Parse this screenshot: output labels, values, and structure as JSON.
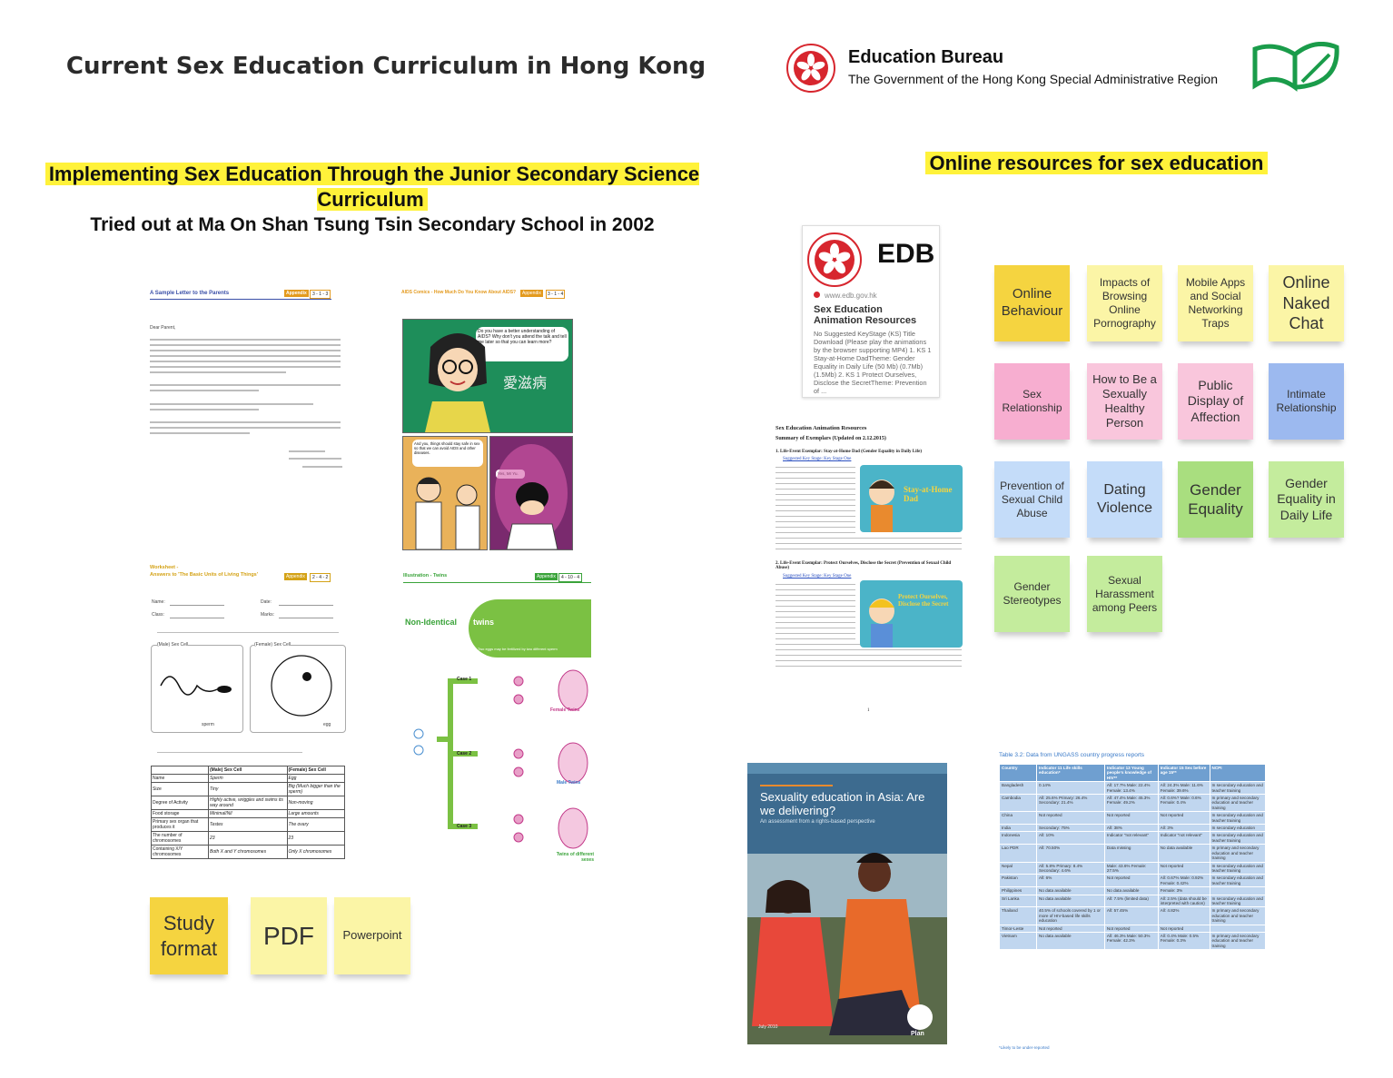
{
  "title": "Current Sex Education Curriculum in Hong Kong",
  "edb": {
    "name": "Education Bureau",
    "government": "The Government of the Hong Kong Special Administrative Region"
  },
  "section_left": {
    "title": "Implementing Sex Education Through the Junior Secondary Science Curriculum",
    "subtitle": "Tried out at Ma On Shan Tsung Tsin Secondary School in 2002"
  },
  "documents": {
    "letter": {
      "heading": "A Sample Letter to the Parents",
      "appendix": "Appendix",
      "appendix_no": "3 - 1 - 3",
      "greeting": "Dear Parent,"
    },
    "comic": {
      "heading": "AIDS Comics - How Much Do You Know About AIDS?",
      "appendix": "Appendix",
      "appendix_no": "3 - 1 - 4",
      "bubble1": "Do you have a better understanding of AIDS? Why don't you attend the talk and tell me later so that you can learn more?",
      "chinese": "愛滋病",
      "bubble2": "And you, things should stay safe in sex so that we can avoid AIDS and other diseases.",
      "bubble3": "Yes, Mr Yu."
    },
    "worksheet": {
      "heading": "Worksheet -",
      "heading2": "Answers to 'The Basic Units of Living Things'",
      "appendix": "Appendix",
      "appendix_no": "2 - 4 - 2",
      "name_label": "Name:",
      "class_label": "Class:",
      "date_label": "Date:",
      "marks_label": "Marks:",
      "male_cell": "(Male) Sex Cell",
      "female_cell": "(Female) Sex Cell",
      "sperm": "sperm",
      "egg": "egg",
      "col_male": "(Male) Sex Cell",
      "col_female": "(Female) Sex Cell",
      "rows": [
        [
          "Name",
          "Sperm",
          "Egg"
        ],
        [
          "Size",
          "Tiny",
          "Big (Much bigger than the sperm)"
        ],
        [
          "Degree of Activity",
          "Highly active, wriggles and swims its way around",
          "Non-moving"
        ],
        [
          "Food storage",
          "Minimal/Nil",
          "Large amounts"
        ],
        [
          "Primary sex organ that produces it",
          "Testes",
          "The ovary"
        ],
        [
          "The number of chromosomes",
          "23",
          "23"
        ],
        [
          "Containing X/Y chromosomes",
          "Both X and Y chromosomes",
          "Only X chromosomes"
        ]
      ]
    },
    "twins": {
      "heading": "Illustration - Twins",
      "appendix": "Appendix",
      "appendix_no": "4 - 10 - 4",
      "banner_left": "Non-Identical",
      "banner_right": "twins",
      "banner_note": "Two eggs may be fertilized by two different sperm",
      "case1": "Case 1",
      "case2": "Case 2",
      "case3": "Case 3",
      "female_twins": "Female Twins",
      "male_twins": "Male Twins",
      "mixed_twins": "Twins of different sexes"
    }
  },
  "study_notes": [
    {
      "label": "Study format",
      "color": "yellow"
    },
    {
      "label": "PDF",
      "color": "lyellow"
    },
    {
      "label": "Powerpoint",
      "color": "lyellow"
    }
  ],
  "section_right": {
    "title": "Online resources for sex education"
  },
  "resource_card": {
    "logo_text": "EDB",
    "url": "www.edb.gov.hk",
    "title": "Sex Education Animation Resources",
    "description": "No Suggested KeyStage (KS) Title Download (Please play the animations by the browser supporting MP4) 1. KS 1 Stay-at-Home DadTheme: Gender Equality in Daily Life (50 Mb) (0.7Mb) (1.5Mb) 2. KS 1 Protect Ourselves, Disclose the SecretTheme: Prevention of ..."
  },
  "animation_doc": {
    "title": "Sex Education Animation Resources",
    "subtitle": "Summary of Exemplars (Updated on 2.12.2015)",
    "item1_title": "1. Life-Event Exemplar: Stay-at-Home Dad (Gender Equality in Daily Life)",
    "item1_stage": "Suggested Key Stage: Key Stage One",
    "item1_thumb": "Stay-at-Home Dad",
    "item2_title": "2. Life-Event Exemplar: Protect Ourselves, Disclose the Secret (Prevention of Sexual Child Abuse)",
    "item2_stage": "Suggested Key Stage: Key Stage One",
    "item2_thumb": "Protect Ourselves, Disclose the Secret",
    "page_no": "1"
  },
  "topic_notes": [
    {
      "label": "Online Behaviour",
      "color": "yellow"
    },
    {
      "label": "Impacts of Browsing Online Pornography",
      "color": "lyellow"
    },
    {
      "label": "Mobile Apps and Social Networking Traps",
      "color": "lyellow"
    },
    {
      "label": "Online Naked Chat",
      "color": "lyellow"
    },
    {
      "label": "Sex Relationship",
      "color": "pink"
    },
    {
      "label": "How to Be a Sexually Healthy Person",
      "color": "lpink"
    },
    {
      "label": "Public Display of Affection",
      "color": "lpink"
    },
    {
      "label": "Intimate Relationship",
      "color": "blue"
    },
    {
      "label": "Prevention of Sexual Child Abuse",
      "color": "lblue"
    },
    {
      "label": "Dating Violence",
      "color": "lblue"
    },
    {
      "label": "Gender Equality",
      "color": "green"
    },
    {
      "label": "Gender Equality in Daily Life",
      "color": "lgreen"
    },
    {
      "label": "Gender Stereotypes",
      "color": "lgreen"
    },
    {
      "label": "Sexual Harassment among Peers",
      "color": "lgreen"
    }
  ],
  "booklet": {
    "title": "Sexuality education in Asia: Are we delivering?",
    "subtitle": "An assessment from a rights-based perspective",
    "publisher": "Plan",
    "date": "July 2010"
  },
  "ungass_table": {
    "caption": "Table 3.2: Data from UNGASS country progress reports",
    "headers": [
      "Country",
      "Indicator 11 Life skills education*",
      "Indicator 13 Young people's knowledge of HIV**",
      "Indicator 15 Sex before age 15**",
      "NCPI"
    ],
    "rows": [
      [
        "Bangladesh",
        "0.14%",
        "All: 17.7% Male: 22.4% Female: 13.4%",
        "All: 24.3% Male: 11.6% Female: 39.6%",
        "In secondary education and teacher training"
      ],
      [
        "Cambodia",
        "All: 25.6% Primary: 26.4% Secondary: 21.4%",
        "All: 47.4% Male: 45.3% Female: 49.2%",
        "All: 0.6%? Male: 0.6% Female: 0.4%",
        "In primary and secondary education and teacher training"
      ],
      [
        "China",
        "Not reported",
        "Not reported",
        "Not reported",
        "In secondary education and teacher training"
      ],
      [
        "India",
        "Secondary: 75%",
        "All: 38%",
        "All: 3%",
        "In secondary education"
      ],
      [
        "Indonesia",
        "All: 10%",
        "Indicator \"not relevant\"",
        "Indicator \"not relevant\"",
        "In secondary education and teacher training"
      ],
      [
        "Lao PDR",
        "All: 70.50%",
        "Data missing",
        "No data available",
        "In primary and secondary education and teacher training"
      ],
      [
        "Nepal",
        "All: 5.8% Primary: 8.4% Secondary: 4.6%",
        "Male: 43.6% Female: 27.5%",
        "Not reported",
        "In secondary education and teacher training"
      ],
      [
        "Pakistan",
        "All: 6%",
        "Not reported",
        "All: 0.67% Male: 0.92% Female: 0.42%",
        "In secondary education and teacher training"
      ],
      [
        "Philippines",
        "No data available",
        "No data available",
        "Female: 3%",
        ""
      ],
      [
        "Sri Lanka",
        "No data available",
        "All: 7.5% (limited data)",
        "All: 2.5% (data should be interpreted with caution)",
        "In secondary education and teacher training"
      ],
      [
        "Thailand",
        "40.5% of schools covered by 1 or more of HIV-based life skills education",
        "All: 57.45%",
        "All: 4.82%",
        "In primary and secondary education and teacher training"
      ],
      [
        "Timor-Leste",
        "Not reported",
        "Not reported",
        "Not reported",
        ""
      ],
      [
        "Vietnam",
        "No data available",
        "All: 46.3% Male: 50.3% Female: 42.3%",
        "All: 0.4% Male: 0.5% Female: 0.3%",
        "In primary and secondary education and teacher training"
      ]
    ],
    "footnote": "*Likely to be under-reported"
  },
  "colors": {
    "highlight": "#fff23a",
    "edb_red": "#d7262e",
    "leaf_green": "#1a9c4a"
  }
}
